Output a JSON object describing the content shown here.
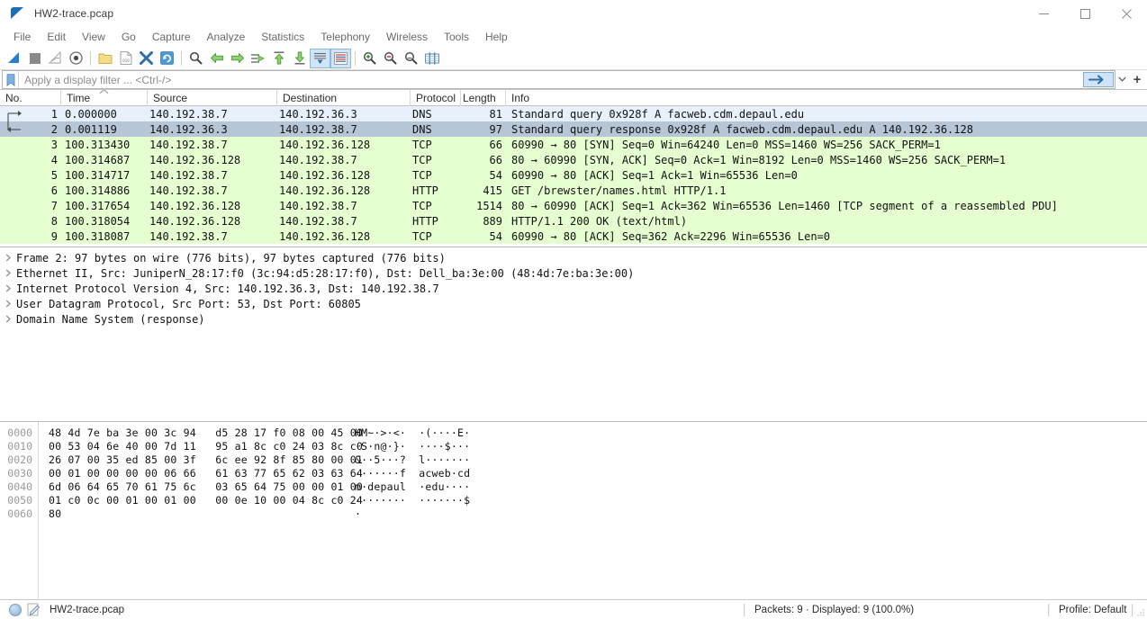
{
  "window": {
    "title": "HW2-trace.pcap",
    "app_icon": "wireshark-fin-icon",
    "minimize_label": "Minimize",
    "maximize_label": "Maximize",
    "close_label": "Close"
  },
  "menubar": {
    "items": [
      {
        "label": "File"
      },
      {
        "label": "Edit"
      },
      {
        "label": "View"
      },
      {
        "label": "Go"
      },
      {
        "label": "Capture"
      },
      {
        "label": "Analyze"
      },
      {
        "label": "Statistics"
      },
      {
        "label": "Telephony"
      },
      {
        "label": "Wireless"
      },
      {
        "label": "Tools"
      },
      {
        "label": "Help"
      }
    ]
  },
  "toolbar": {
    "buttons": [
      {
        "name": "start-capture-icon",
        "tooltip": "Start capturing packets"
      },
      {
        "name": "stop-capture-icon",
        "tooltip": "Stop capturing packets"
      },
      {
        "name": "restart-capture-icon",
        "tooltip": "Restart current capture"
      },
      {
        "name": "capture-options-icon",
        "tooltip": "Capture options"
      },
      {
        "name": "open-file-icon",
        "tooltip": "Open a capture file"
      },
      {
        "name": "save-file-icon",
        "tooltip": "Save this capture file"
      },
      {
        "name": "close-file-icon",
        "tooltip": "Close this capture file"
      },
      {
        "name": "reload-file-icon",
        "tooltip": "Reload this file"
      },
      {
        "name": "find-packet-icon",
        "tooltip": "Find a packet"
      },
      {
        "name": "go-back-icon",
        "tooltip": "Go back in packet history"
      },
      {
        "name": "go-forward-icon",
        "tooltip": "Go forward in packet history"
      },
      {
        "name": "go-to-packet-icon",
        "tooltip": "Go to the packet"
      },
      {
        "name": "go-to-first-packet-icon",
        "tooltip": "Go to the first packet"
      },
      {
        "name": "go-to-last-packet-icon",
        "tooltip": "Go to the last packet"
      },
      {
        "name": "auto-scroll-icon",
        "tooltip": "Auto scroll in live capture"
      },
      {
        "name": "colorize-packets-icon",
        "tooltip": "Colorize packet list"
      },
      {
        "name": "zoom-in-icon",
        "tooltip": "Zoom in"
      },
      {
        "name": "zoom-out-icon",
        "tooltip": "Zoom out"
      },
      {
        "name": "zoom-reset-icon",
        "tooltip": "Normal size"
      },
      {
        "name": "resize-columns-icon",
        "tooltip": "Resize columns"
      }
    ]
  },
  "filter": {
    "bookmark_icon": "filter-bookmark-icon",
    "value": "",
    "placeholder": "Apply a display filter ... <Ctrl-/>",
    "apply_icon": "filter-apply-arrow-icon",
    "history_icon": "chevron-down-icon",
    "add_label": "+"
  },
  "packet_list": {
    "columns": [
      {
        "key": "no",
        "label": "No."
      },
      {
        "key": "time",
        "label": "Time"
      },
      {
        "key": "src",
        "label": "Source"
      },
      {
        "key": "dst",
        "label": "Destination"
      },
      {
        "key": "proto",
        "label": "Protocol"
      },
      {
        "key": "len",
        "label": "Length"
      },
      {
        "key": "info",
        "label": "Info"
      }
    ],
    "sort_column": "Time",
    "sort_direction": "ascending",
    "rows": [
      {
        "no": "1",
        "time": "0.000000",
        "src": "140.192.38.7",
        "dst": "140.192.36.3",
        "proto": "DNS",
        "len": "81",
        "info": "Standard query 0x928f A facweb.cdm.depaul.edu",
        "style": "c-dns",
        "marker": "request"
      },
      {
        "no": "2",
        "time": "0.001119",
        "src": "140.192.36.3",
        "dst": "140.192.38.7",
        "proto": "DNS",
        "len": "97",
        "info": "Standard query response 0x928f A facweb.cdm.depaul.edu A 140.192.36.128",
        "style": "c-sel",
        "marker": "response"
      },
      {
        "no": "3",
        "time": "100.313430",
        "src": "140.192.38.7",
        "dst": "140.192.36.128",
        "proto": "TCP",
        "len": "66",
        "info": "60990 → 80 [SYN] Seq=0 Win=64240 Len=0 MSS=1460 WS=256 SACK_PERM=1",
        "style": "c-tcp",
        "marker": ""
      },
      {
        "no": "4",
        "time": "100.314687",
        "src": "140.192.36.128",
        "dst": "140.192.38.7",
        "proto": "TCP",
        "len": "66",
        "info": "80 → 60990 [SYN, ACK] Seq=0 Ack=1 Win=8192 Len=0 MSS=1460 WS=256 SACK_PERM=1",
        "style": "c-tcp",
        "marker": ""
      },
      {
        "no": "5",
        "time": "100.314717",
        "src": "140.192.38.7",
        "dst": "140.192.36.128",
        "proto": "TCP",
        "len": "54",
        "info": "60990 → 80 [ACK] Seq=1 Ack=1 Win=65536 Len=0",
        "style": "c-tcp",
        "marker": ""
      },
      {
        "no": "6",
        "time": "100.314886",
        "src": "140.192.38.7",
        "dst": "140.192.36.128",
        "proto": "HTTP",
        "len": "415",
        "info": "GET /brewster/names.html HTTP/1.1",
        "style": "c-tcp",
        "marker": ""
      },
      {
        "no": "7",
        "time": "100.317654",
        "src": "140.192.36.128",
        "dst": "140.192.38.7",
        "proto": "TCP",
        "len": "1514",
        "info": "80 → 60990 [ACK] Seq=1 Ack=362 Win=65536 Len=1460 [TCP segment of a reassembled PDU]",
        "style": "c-tcp",
        "marker": ""
      },
      {
        "no": "8",
        "time": "100.318054",
        "src": "140.192.36.128",
        "dst": "140.192.38.7",
        "proto": "HTTP",
        "len": "889",
        "info": "HTTP/1.1 200 OK  (text/html)",
        "style": "c-tcp",
        "marker": ""
      },
      {
        "no": "9",
        "time": "100.318087",
        "src": "140.192.38.7",
        "dst": "140.192.36.128",
        "proto": "TCP",
        "len": "54",
        "info": "60990 → 80 [ACK] Seq=362 Ack=2296 Win=65536 Len=0",
        "style": "c-tcp",
        "marker": ""
      }
    ]
  },
  "packet_detail": {
    "lines": [
      {
        "text": "Frame 2: 97 bytes on wire (776 bits), 97 bytes captured (776 bits)",
        "expanded": false
      },
      {
        "text": "Ethernet II, Src: JuniperN_28:17:f0 (3c:94:d5:28:17:f0), Dst: Dell_ba:3e:00 (48:4d:7e:ba:3e:00)",
        "expanded": false
      },
      {
        "text": "Internet Protocol Version 4, Src: 140.192.36.3, Dst: 140.192.38.7",
        "expanded": false
      },
      {
        "text": "User Datagram Protocol, Src Port: 53, Dst Port: 60805",
        "expanded": false
      },
      {
        "text": "Domain Name System (response)",
        "expanded": false
      }
    ]
  },
  "hex_dump": {
    "lines": [
      {
        "offset": "0000",
        "bytes": "48 4d 7e ba 3e 00 3c 94   d5 28 17 f0 08 00 45 00",
        "ascii": "HM~·>·<·  ·(····E·"
      },
      {
        "offset": "0010",
        "bytes": "00 53 04 6e 40 00 7d 11   95 a1 8c c0 24 03 8c c0",
        "ascii": "·S·n@·}·  ····$···"
      },
      {
        "offset": "0020",
        "bytes": "26 07 00 35 ed 85 00 3f   6c ee 92 8f 85 80 00 01",
        "ascii": "&··5···?  l·······"
      },
      {
        "offset": "0030",
        "bytes": "00 01 00 00 00 00 06 66   61 63 77 65 62 03 63 64",
        "ascii": "·······f  acweb·cd"
      },
      {
        "offset": "0040",
        "bytes": "6d 06 64 65 70 61 75 6c   03 65 64 75 00 00 01 00",
        "ascii": "m·depaul  ·edu····"
      },
      {
        "offset": "0050",
        "bytes": "01 c0 0c 00 01 00 01 00   00 0e 10 00 04 8c c0 24",
        "ascii": "········  ·······$"
      },
      {
        "offset": "0060",
        "bytes": "80",
        "ascii": "·"
      }
    ]
  },
  "statusbar": {
    "expert_icon": "expert-info-icon",
    "comment_icon": "capture-comment-icon",
    "file_name": "HW2-trace.pcap",
    "packets_text": "Packets: 9 · Displayed: 9 (100.0%)",
    "profile_text": "Profile: Default"
  },
  "colors": {
    "dns_row": "#e8f1fb",
    "selected_row": "#b7c6d6",
    "tcp_row": "#e6ffd0",
    "accent": "#1a6fb5",
    "toolbar_active": "#cfe4f7"
  }
}
